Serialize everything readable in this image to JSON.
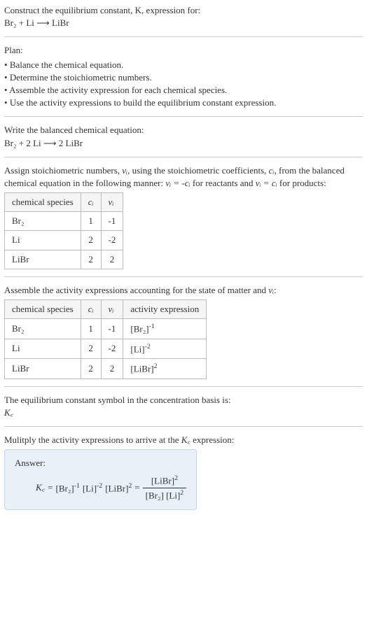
{
  "intro": {
    "line1": "Construct the equilibrium constant, K, expression for:",
    "equation": "Br₂ + Li ⟶ LiBr"
  },
  "plan": {
    "heading": "Plan:",
    "items": [
      "Balance the chemical equation.",
      "Determine the stoichiometric numbers.",
      "Assemble the activity expression for each chemical species.",
      "Use the activity expressions to build the equilibrium constant expression."
    ]
  },
  "balanced": {
    "heading": "Write the balanced chemical equation:",
    "equation": "Br₂ + 2 Li ⟶ 2 LiBr"
  },
  "assign": {
    "text_a": "Assign stoichiometric numbers, ",
    "nu": "νᵢ",
    "text_b": ", using the stoichiometric coefficients, ",
    "ci": "cᵢ",
    "text_c": ", from the balanced chemical equation in the following manner: ",
    "rel1": "νᵢ = -cᵢ",
    "text_d": " for reactants and ",
    "rel2": "νᵢ = cᵢ",
    "text_e": " for products:"
  },
  "table1": {
    "headers": [
      "chemical species",
      "cᵢ",
      "νᵢ"
    ],
    "rows": [
      [
        "Br₂",
        "1",
        "-1"
      ],
      [
        "Li",
        "2",
        "-2"
      ],
      [
        "LiBr",
        "2",
        "2"
      ]
    ]
  },
  "assemble": {
    "text_a": "Assemble the activity expressions accounting for the state of matter and ",
    "nu": "νᵢ",
    "text_b": ":"
  },
  "table2": {
    "headers": [
      "chemical species",
      "cᵢ",
      "νᵢ",
      "activity expression"
    ],
    "rows": [
      {
        "sp": "Br₂",
        "c": "1",
        "v": "-1",
        "act_base": "[Br₂]",
        "act_exp": "-1"
      },
      {
        "sp": "Li",
        "c": "2",
        "v": "-2",
        "act_base": "[Li]",
        "act_exp": "-2"
      },
      {
        "sp": "LiBr",
        "c": "2",
        "v": "2",
        "act_base": "[LiBr]",
        "act_exp": "2"
      }
    ]
  },
  "symbol": {
    "text": "The equilibrium constant symbol in the concentration basis is:",
    "kc": "K꜀"
  },
  "multiply": {
    "text_a": "Mulitply the activity expressions to arrive at the ",
    "kc": "K꜀",
    "text_b": " expression:"
  },
  "answer": {
    "label": "Answer:",
    "kc": "K꜀",
    "eq": " = ",
    "t1_base": "[Br₂]",
    "t1_exp": "-1",
    "t2_base": "[Li]",
    "t2_exp": "-2",
    "t3_base": "[LiBr]",
    "t3_exp": "2",
    "frac_eq": " = ",
    "num_base": "[LiBr]",
    "num_exp": "2",
    "den1_base": "[Br₂]",
    "den2_base": "[Li]",
    "den2_exp": "2"
  }
}
